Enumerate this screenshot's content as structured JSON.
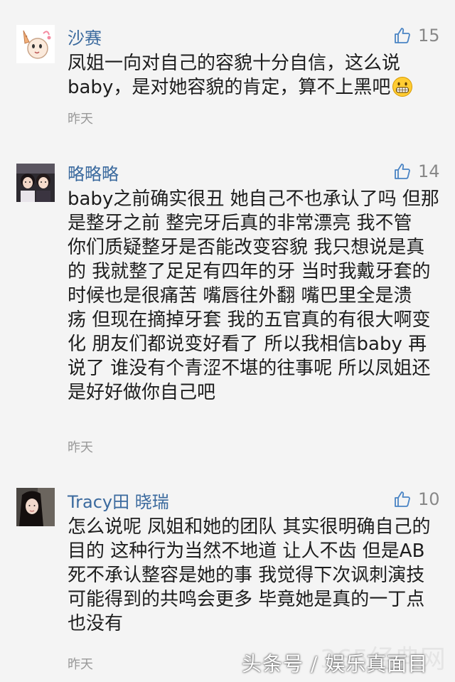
{
  "comments": [
    {
      "username": "沙赛",
      "likes": "15",
      "lines": [
        "凤姐一向对自己的容貌十分自信，这么说",
        "baby，是对她容貌的肯定，算不上黑吧"
      ],
      "time": "昨天",
      "avatar_icon": "cartoon-avatar-icon"
    },
    {
      "username": "略略略",
      "likes": "14",
      "lines": [
        "baby之前确实很丑 她自己不也承认了吗 但那",
        "是整牙之前  整完牙后真的非常漂亮  我不管",
        "你们质疑整牙是否能改变容貌   我只想说是真",
        "的 我就整了足足有四年的牙  当时我戴牙套的",
        "时候也是很痛苦  嘴唇往外翻  嘴巴里全是溃",
        "疡 但现在摘掉牙套 我的五官真的有很大啊变",
        "化 朋友们都说变好看了   所以我相信baby  再",
        "说了 谁没有个青涩不堪的往事呢  所以凤姐还",
        "是好好做你自己吧"
      ],
      "time": "昨天",
      "avatar_icon": "two-girls-photo-avatar"
    },
    {
      "username": "Tracy田 晓瑞",
      "likes": "10",
      "lines": [
        "怎么说呢  凤姐和她的团队  其实很明确自己的",
        "目的 这种行为当然不地道 让人不齿 但是AB",
        "死不承认整容是她的事 我觉得下次讽刺演技",
        "可能得到的共鸣会更多 毕竟她是真的一丁点",
        "也没有"
      ],
      "time": "昨天",
      "avatar_icon": "girl-photo-avatar"
    }
  ],
  "watermark": {
    "text": "头条号 / 娱乐真面目",
    "faint_text": "365经典网"
  },
  "colors": {
    "background": "#f4f4f4",
    "username": "#3b6a9e",
    "like_icon": "#4a84c4",
    "meta": "#999999"
  }
}
